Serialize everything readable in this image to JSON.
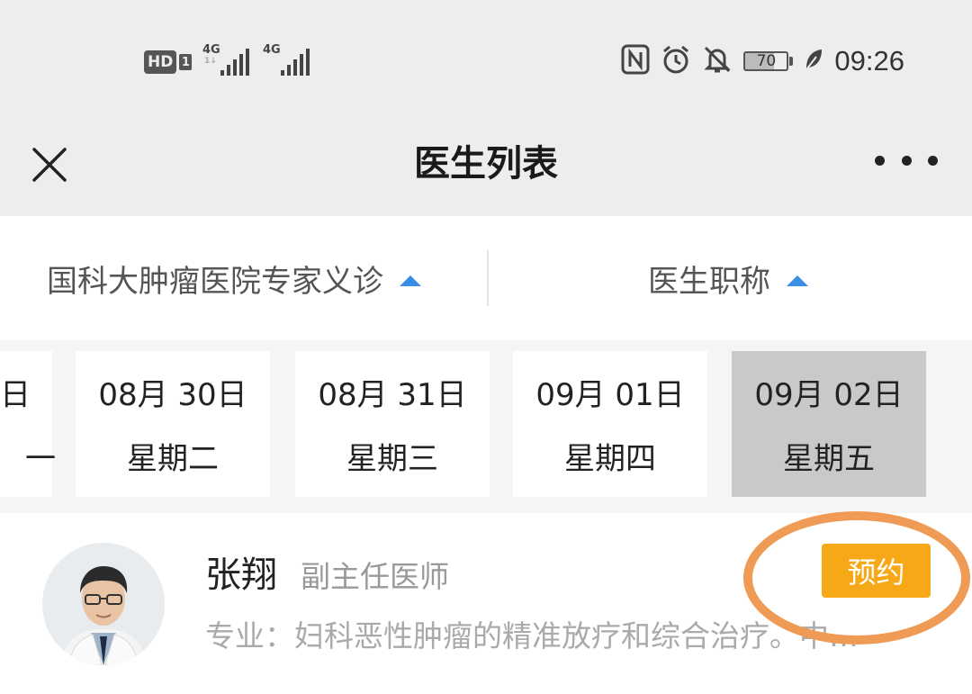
{
  "status_bar": {
    "hd_label": "HD",
    "sim_label": "1",
    "signal_1_label": "4G",
    "signal_1_sub": "1↓",
    "signal_2_label": "4G",
    "battery_level": "70",
    "time": "09:26",
    "icons": [
      "nfc-icon",
      "alarm-icon",
      "mute-icon",
      "battery-icon",
      "eco-leaf-icon"
    ]
  },
  "nav": {
    "title": "医生列表"
  },
  "filters": {
    "hospital_label": "国科大肿瘤医院专家义诊",
    "title_label": "医生职称",
    "arrow_color": "#3a8ee6"
  },
  "dates": [
    {
      "date": "日",
      "weekday": "一"
    },
    {
      "date": "08月 30日",
      "weekday": "星期二"
    },
    {
      "date": "08月 31日",
      "weekday": "星期三"
    },
    {
      "date": "09月 01日",
      "weekday": "星期四"
    },
    {
      "date": "09月 02日",
      "weekday": "星期五",
      "selected": true
    }
  ],
  "doctor": {
    "name": "张翔",
    "title": "副主任医师",
    "specialty": "专业：妇科恶性肿瘤的精准放疗和综合治疗。中…",
    "book_label": "预约",
    "book_color": "#f7a816"
  },
  "annotation_color": "#ef9b55"
}
